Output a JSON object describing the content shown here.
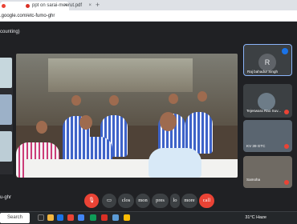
{
  "browser": {
    "tabs": [
      {
        "label": "",
        "active": true
      },
      {
        "label": "ppt on sarai-meerut.pdf",
        "active": false
      }
    ],
    "new_tab_label": "+",
    "url": ".google.com/etc-fumo-ghr"
  },
  "meet": {
    "header_title": "counting)",
    "meeting_name": "u-ghr",
    "main_caption": "",
    "participants": [
      {
        "name": "Raj bahadur Singh",
        "initial": "R"
      },
      {
        "name": "Tejeswara Rao Suv..."
      },
      {
        "name": "KV 39 GTC"
      },
      {
        "name": "Samoha"
      }
    ],
    "controls": [
      "clos",
      "mon",
      "pres",
      "lo",
      "more",
      "call"
    ]
  },
  "taskbar": {
    "search_label": "Search",
    "temperature": "31°C",
    "weather": "Haze"
  },
  "colors": {
    "background": "#202124",
    "accent_red": "#ea4335",
    "accent_blue": "#1a73e8"
  }
}
